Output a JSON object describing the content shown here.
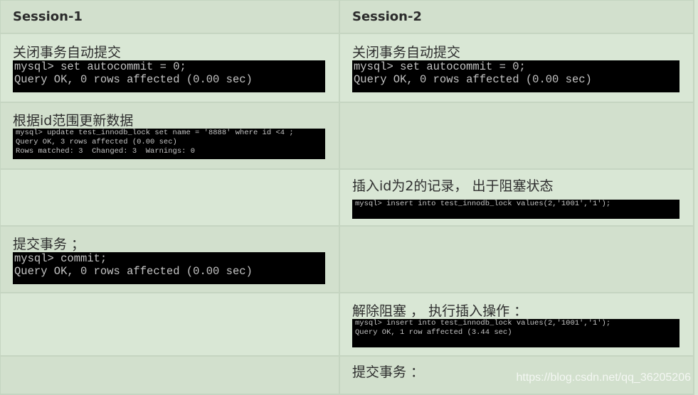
{
  "header": {
    "col1": "Session-1",
    "col2": "Session-2"
  },
  "rows": [
    {
      "s1": {
        "label": "关闭事务自动提交",
        "terminal": "mysql> set autocommit = 0;\nQuery OK, 0 rows affected (0.00 sec)"
      },
      "s2": {
        "label": "关闭事务自动提交",
        "terminal": "mysql> set autocommit = 0;\nQuery OK, 0 rows affected (0.00 sec)"
      }
    },
    {
      "s1": {
        "label": "根据id范围更新数据",
        "terminal": "mysql> update test_innodb_lock set name = '8888' where id <4 ;\nQuery OK, 3 rows affected (0.00 sec)\nRows matched: 3  Changed: 3  Warnings: 0"
      },
      "s2": null
    },
    {
      "s1": null,
      "s2": {
        "label": "插入id为2的记录， 出于阻塞状态",
        "terminal": "mysql> insert into test_innodb_lock values(2,'1001','1');"
      }
    },
    {
      "s1": {
        "label": "提交事务 ；",
        "terminal": "mysql> commit;\nQuery OK, 0 rows affected (0.00 sec)"
      },
      "s2": null
    },
    {
      "s1": null,
      "s2": {
        "label": "解除阻塞 ， 执行插入操作 ：",
        "terminal": "mysql> insert into test_innodb_lock values(2,'1001','1');\nQuery OK, 1 row affected (3.44 sec)"
      }
    },
    {
      "s1": null,
      "s2": {
        "label": "提交事务 ："
      }
    }
  ],
  "watermark": "https://blog.csdn.net/qq_36205206",
  "colors": {
    "header_bg": "#d2e0cd",
    "row_light_bg": "#d9e7d5",
    "border": "#c5d5c1",
    "terminal_bg": "#000000",
    "terminal_text": "#c4c4c4"
  }
}
